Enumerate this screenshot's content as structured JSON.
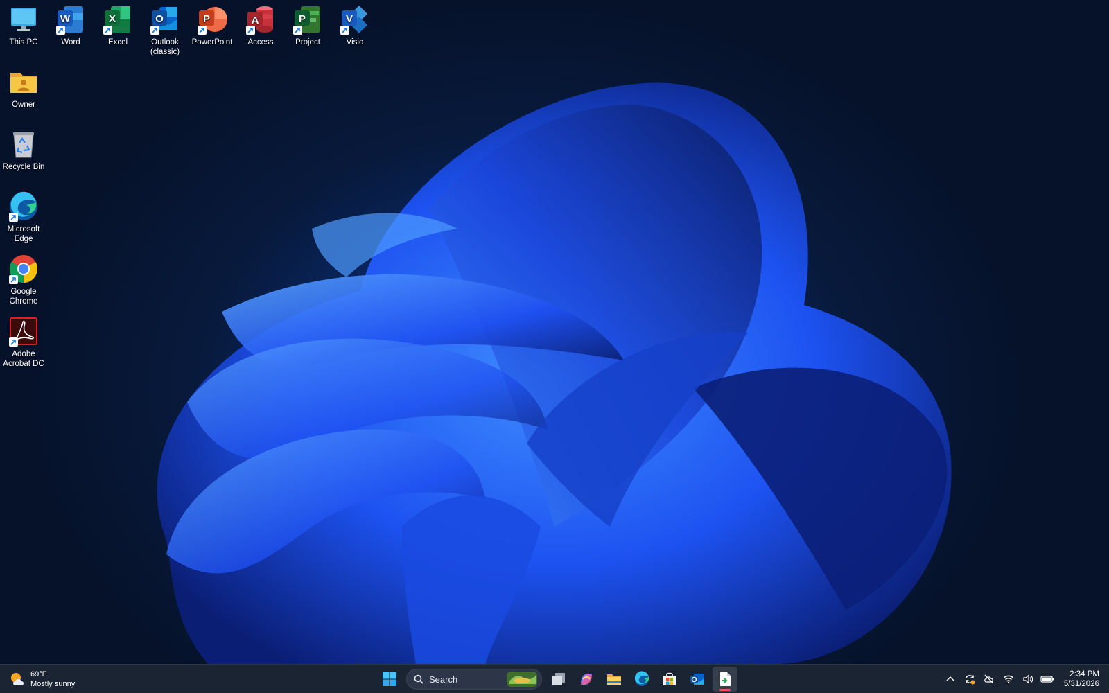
{
  "desktop_icons": [
    {
      "label": "This PC",
      "icon": "monitor-icon"
    },
    {
      "label": "Word",
      "icon": "word-icon"
    },
    {
      "label": "Excel",
      "icon": "excel-icon"
    },
    {
      "label": "Outlook (classic)",
      "icon": "outlook-icon"
    },
    {
      "label": "PowerPoint",
      "icon": "powerpoint-icon"
    },
    {
      "label": "Access",
      "icon": "access-icon"
    },
    {
      "label": "Project",
      "icon": "project-icon"
    },
    {
      "label": "Visio",
      "icon": "visio-icon"
    },
    {
      "label": "Owner",
      "icon": "user-folder-icon"
    },
    {
      "label": "Recycle Bin",
      "icon": "recycle-bin-icon"
    },
    {
      "label": "Microsoft Edge",
      "icon": "edge-icon"
    },
    {
      "label": "Google Chrome",
      "icon": "chrome-icon"
    },
    {
      "label": "Adobe Acrobat DC",
      "icon": "acrobat-icon"
    }
  ],
  "taskbar": {
    "weather": {
      "temperature": "69°F",
      "condition": "Mostly sunny",
      "icon": "sun-cloud-icon"
    },
    "search_label": "Search",
    "pinned": [
      "start-icon",
      "task-view-icon",
      "copilot-icon",
      "file-explorer-icon",
      "edge-icon",
      "store-icon",
      "outlook-icon",
      "document-app-icon"
    ],
    "tray": [
      "chevron-up-icon",
      "sync-icon",
      "cloud-offline-icon",
      "wifi-icon",
      "volume-icon",
      "battery-icon"
    ],
    "clock": {
      "time": "2:34 PM",
      "date": "5/31/2026"
    }
  },
  "colors": {
    "taskbar_bg": "#1b2433",
    "wallpaper_accent": "#1f5bff",
    "active_indicator": "#f04e6a"
  }
}
